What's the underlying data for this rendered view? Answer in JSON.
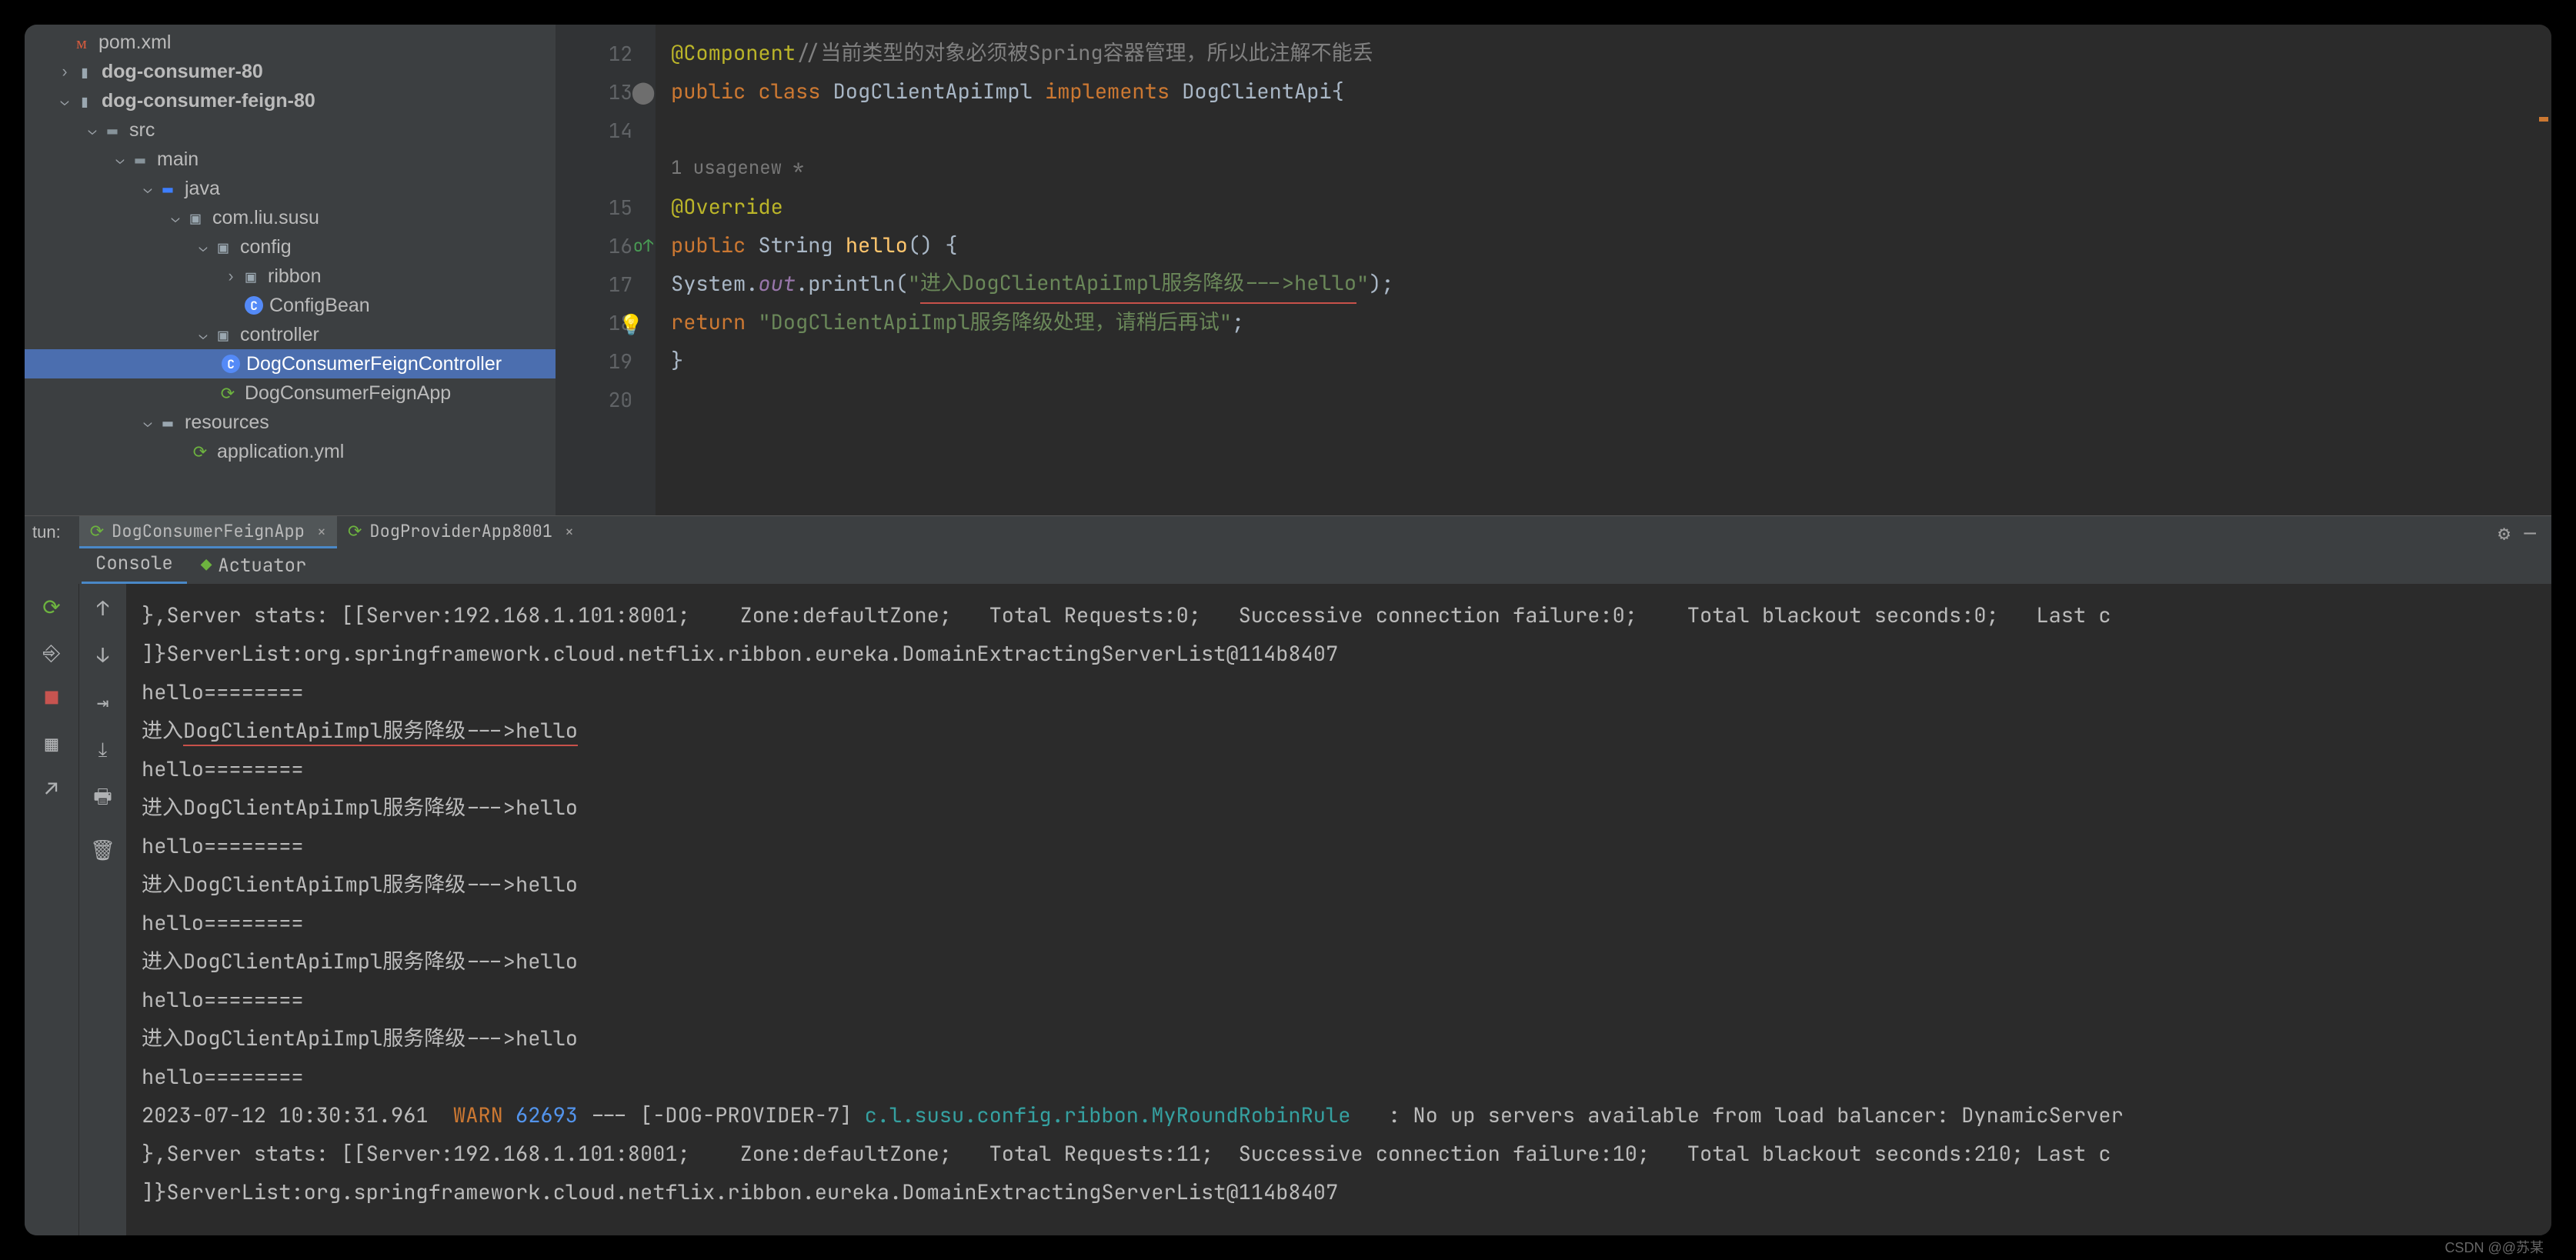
{
  "tree": {
    "pom": "pom.xml",
    "mod1": "dog-consumer-80",
    "mod2": "dog-consumer-feign-80",
    "src": "src",
    "main": "main",
    "java": "java",
    "pkg": "com.liu.susu",
    "config": "config",
    "ribbon": "ribbon",
    "configbean": "ConfigBean",
    "controller": "controller",
    "dcfc": "DogConsumerFeignController",
    "dcfa": "DogConsumerFeignApp",
    "resources": "resources",
    "appyml": "application.yml"
  },
  "code": {
    "l12_ann": "@Component",
    "l12_cmt": "//当前类型的对象必须被Spring容器管理，所以此注解不能丢",
    "l13_kw1": "public class ",
    "l13_cls": "DogClientApiImpl ",
    "l13_kw2": "implements ",
    "l13_if": "DogClientApi",
    "l13_b": "{",
    "inlay_usage": "1 usage",
    "inlay_new": "new *",
    "l15_ann": "@Override",
    "l16_kw": "public ",
    "l16_ret": "String ",
    "l16_fn": "hello",
    "l16_rest": "() {",
    "l17_a": "System.",
    "l17_out": "out",
    "l17_b": ".println(",
    "l17_q1": "\"",
    "l17_str_u": "进入DogClientApiImpl服务降级--->hello",
    "l17_q2": "\"",
    "l17_c": ");",
    "l18_kw": "return ",
    "l18_str": "\"DogClientApiImpl服务降级处理，请稍后再试\"",
    "l18_s": ";",
    "l19": "}",
    "nums": [
      "12",
      "13",
      "14",
      "",
      "15",
      "16",
      "17",
      "18",
      "19",
      "20"
    ]
  },
  "run": {
    "label": "tun:",
    "tab1": "DogConsumerFeignApp",
    "tab2": "DogProviderApp8001",
    "console": "Console",
    "actuator": "Actuator"
  },
  "console": [
    {
      "t": "},Server stats: [[Server:192.168.1.101:8001;    Zone:defaultZone;   Total Requests:0;   Successive connection failure:0;    Total blackout seconds:0;   Last c"
    },
    {
      "t": "]}ServerList:org.springframework.cloud.netflix.ribbon.eureka.DomainExtractingServerList@114b8407"
    },
    {
      "t": "hello========"
    },
    {
      "t": "进入",
      "u": "DogClientApiImpl服务降级--->hello",
      "rest": ""
    },
    {
      "t": "hello========"
    },
    {
      "t": "进入DogClientApiImpl服务降级--->hello"
    },
    {
      "t": "hello========"
    },
    {
      "t": "进入DogClientApiImpl服务降级--->hello"
    },
    {
      "t": "hello========"
    },
    {
      "t": "进入DogClientApiImpl服务降级--->hello"
    },
    {
      "t": "hello========"
    },
    {
      "t": "进入DogClientApiImpl服务降级--->hello"
    },
    {
      "t": "hello========"
    },
    {
      "ts": "2023-07-12 10:30:31.961  ",
      "lvl": "WARN ",
      "pid": "62693",
      "dash": " --- [-DOG-PROVIDER-7] ",
      "logger": "c.l.susu.config.ribbon.MyRoundRobinRule",
      "msg": "   : No up servers available from load balancer: DynamicServer"
    },
    {
      "t": "},Server stats: [[Server:192.168.1.101:8001;    Zone:defaultZone;   Total Requests:11;  Successive connection failure:10;   Total blackout seconds:210; Last c"
    },
    {
      "t": "]}ServerList:org.springframework.cloud.netflix.ribbon.eureka.DomainExtractingServerList@114b8407"
    }
  ],
  "watermark": "CSDN @@苏某"
}
